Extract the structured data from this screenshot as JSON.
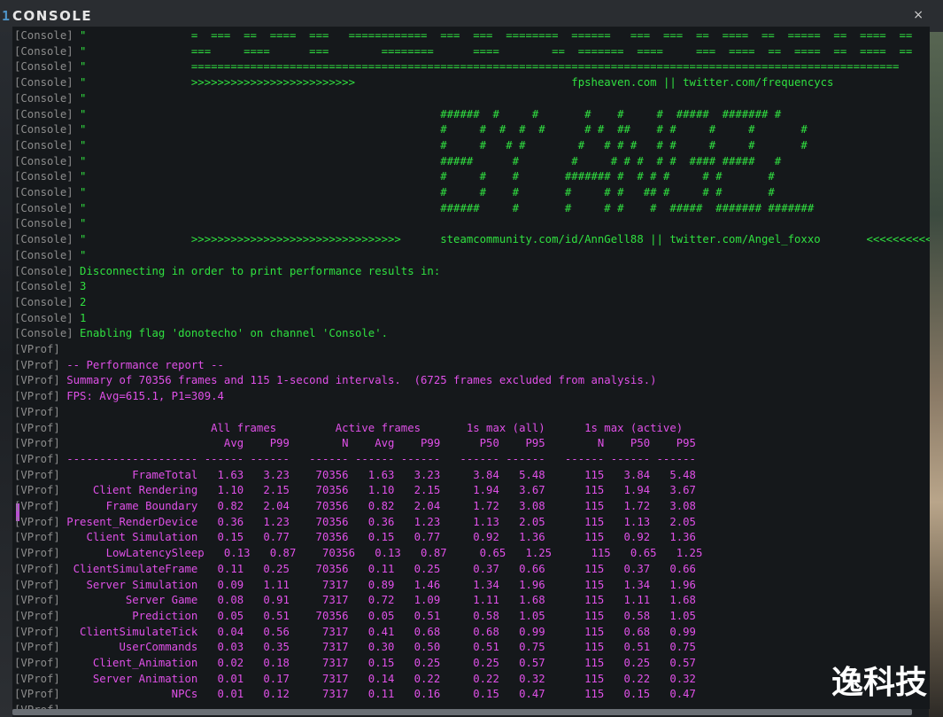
{
  "window": {
    "title_prefix": "1",
    "title": "CONSOLE",
    "close_label": "×"
  },
  "watermark": "逸科技",
  "lines": [
    {
      "tag": "[Console]",
      "text": " \"                =  ===  ==  ====  ===   ============  ===  ===  ========  ======   ===  ===  ==  ====  ==  =====  ==  ====  =="
    },
    {
      "tag": "[Console]",
      "text": " \"                ===     ====      ===        ========      ====        ==  =======  ====     ===  ====  ==  ====  ==  ====  =="
    },
    {
      "tag": "[Console]",
      "text": " \"                ============================================================================================================"
    },
    {
      "tag": "[Console]",
      "text": " \"                >>>>>>>>>>>>>>>>>>>>>>>>>                                 fpsheaven.com || twitter.com/frequencycs                <<<<<<"
    },
    {
      "tag": "[Console]",
      "text": " \""
    },
    {
      "tag": "[Console]",
      "text": " \"                                                      ######  #     #       #    #     #  #####  ####### #"
    },
    {
      "tag": "[Console]",
      "text": " \"                                                      #     #  #  #  #      # #  ##    # #     #     #       #"
    },
    {
      "tag": "[Console]",
      "text": " \"                                                      #     #   # #        #   # # #   # #     #     #       #"
    },
    {
      "tag": "[Console]",
      "text": " \"                                                      #####      #        #     # # #  # #  #### #####   #"
    },
    {
      "tag": "[Console]",
      "text": " \"                                                      #     #    #       ####### #  # # #     # #       #"
    },
    {
      "tag": "[Console]",
      "text": " \"                                                      #     #    #       #     # #   ## #     # #       #"
    },
    {
      "tag": "[Console]",
      "text": " \"                                                      ######     #       #     # #    #  #####  ####### #######"
    },
    {
      "tag": "[Console]",
      "text": " \""
    },
    {
      "tag": "[Console]",
      "text": " \"                >>>>>>>>>>>>>>>>>>>>>>>>>>>>>>>>      steamcommunity.com/id/AnnGell88 || twitter.com/Angel_foxxo       <<<<<<<<<<<"
    },
    {
      "tag": "[Console]",
      "text": " \""
    },
    {
      "tag": "[Console]",
      "text": " Disconnecting in order to print performance results in:"
    },
    {
      "tag": "[Console]",
      "text": " 3"
    },
    {
      "tag": "[Console]",
      "text": " 2"
    },
    {
      "tag": "[Console]",
      "text": " 1"
    },
    {
      "tag": "[Console]",
      "text": " Enabling flag 'donotecho' on channel 'Console'."
    },
    {
      "tag": "[VProf]",
      "text": ""
    },
    {
      "tag": "[VProf]",
      "text": " -- Performance report --"
    },
    {
      "tag": "[VProf]",
      "text": " Summary of 70356 frames and 115 1-second intervals.  (6725 frames excluded from analysis.)"
    },
    {
      "tag": "[VProf]",
      "text": " FPS: Avg=615.1, P1=309.4"
    },
    {
      "tag": "[VProf]",
      "text": ""
    },
    {
      "tag": "[VProf]",
      "text": "                       All frames         Active frames       1s max (all)      1s max (active)"
    },
    {
      "tag": "[VProf]",
      "text": "                         Avg    P99        N    Avg    P99      P50    P95        N    P50    P95"
    },
    {
      "tag": "[VProf]",
      "text": " -------------------- ------ ------   ------ ------ ------   ------ ------   ------ ------ ------"
    },
    {
      "tag": "[VProf]",
      "text": "           FrameTotal   1.63   3.23    70356   1.63   3.23     3.84   5.48      115   3.84   5.48"
    },
    {
      "tag": "[VProf]",
      "text": "     Client Rendering   1.10   2.15    70356   1.10   2.15     1.94   3.67      115   1.94   3.67"
    },
    {
      "tag": "[VProf]",
      "text": "       Frame Boundary   0.82   2.04    70356   0.82   2.04     1.72   3.08      115   1.72   3.08"
    },
    {
      "tag": "[VProf]",
      "text": " Present_RenderDevice   0.36   1.23    70356   0.36   1.23     1.13   2.05      115   1.13   2.05"
    },
    {
      "tag": "[VProf]",
      "text": "    Client Simulation   0.15   0.77    70356   0.15   0.77     0.92   1.36      115   0.92   1.36"
    },
    {
      "tag": "[VProf]",
      "text": "       LowLatencySleep   0.13   0.87    70356   0.13   0.87     0.65   1.25      115   0.65   1.25"
    },
    {
      "tag": "[VProf]",
      "text": "  ClientSimulateFrame   0.11   0.25    70356   0.11   0.25     0.37   0.66      115   0.37   0.66"
    },
    {
      "tag": "[VProf]",
      "text": "    Server Simulation   0.09   1.11     7317   0.89   1.46     1.34   1.96      115   1.34   1.96"
    },
    {
      "tag": "[VProf]",
      "text": "          Server Game   0.08   0.91     7317   0.72   1.09     1.11   1.68      115   1.11   1.68"
    },
    {
      "tag": "[VProf]",
      "text": "           Prediction   0.05   0.51    70356   0.05   0.51     0.58   1.05      115   0.58   1.05"
    },
    {
      "tag": "[VProf]",
      "text": "   ClientSimulateTick   0.04   0.56     7317   0.41   0.68     0.68   0.99      115   0.68   0.99"
    },
    {
      "tag": "[VProf]",
      "text": "         UserCommands   0.03   0.35     7317   0.30   0.50     0.51   0.75      115   0.51   0.75"
    },
    {
      "tag": "[VProf]",
      "text": "     Client_Animation   0.02   0.18     7317   0.15   0.25     0.25   0.57      115   0.25   0.57"
    },
    {
      "tag": "[VProf]",
      "text": "     Server Animation   0.01   0.17     7317   0.14   0.22     0.22   0.32      115   0.22   0.32"
    },
    {
      "tag": "[VProf]",
      "text": "                 NPCs   0.01   0.12     7317   0.11   0.16     0.15   0.47      115   0.15   0.47"
    },
    {
      "tag": "[VProf]",
      "text": ""
    }
  ],
  "colors": {
    "console": "#30e040",
    "vprof": "#e050e8",
    "tag": "#8c8c8c",
    "accent": "#4f95c9"
  }
}
